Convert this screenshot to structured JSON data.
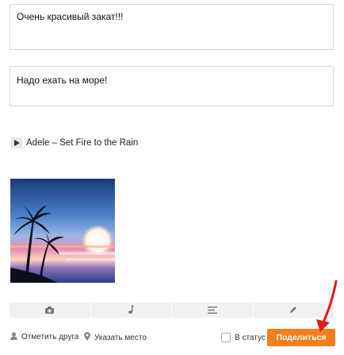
{
  "post": {
    "text1": "Очень красивый закат!!!",
    "text2": "Надо ехать на море!"
  },
  "music": {
    "track": "Adele – Set Fire to the Rain"
  },
  "toolbar": {
    "icons": [
      "camera-icon",
      "music-note-icon",
      "text-lines-icon",
      "pencil-icon"
    ]
  },
  "bottom": {
    "tag_friend": "Отметить друга",
    "location": "Указать место",
    "to_status": "В статус",
    "share": "Поделиться"
  },
  "colors": {
    "share_button": "#f07f1c",
    "arrow": "#e01a1a",
    "toolbar_bg": "#f1f1f1"
  }
}
